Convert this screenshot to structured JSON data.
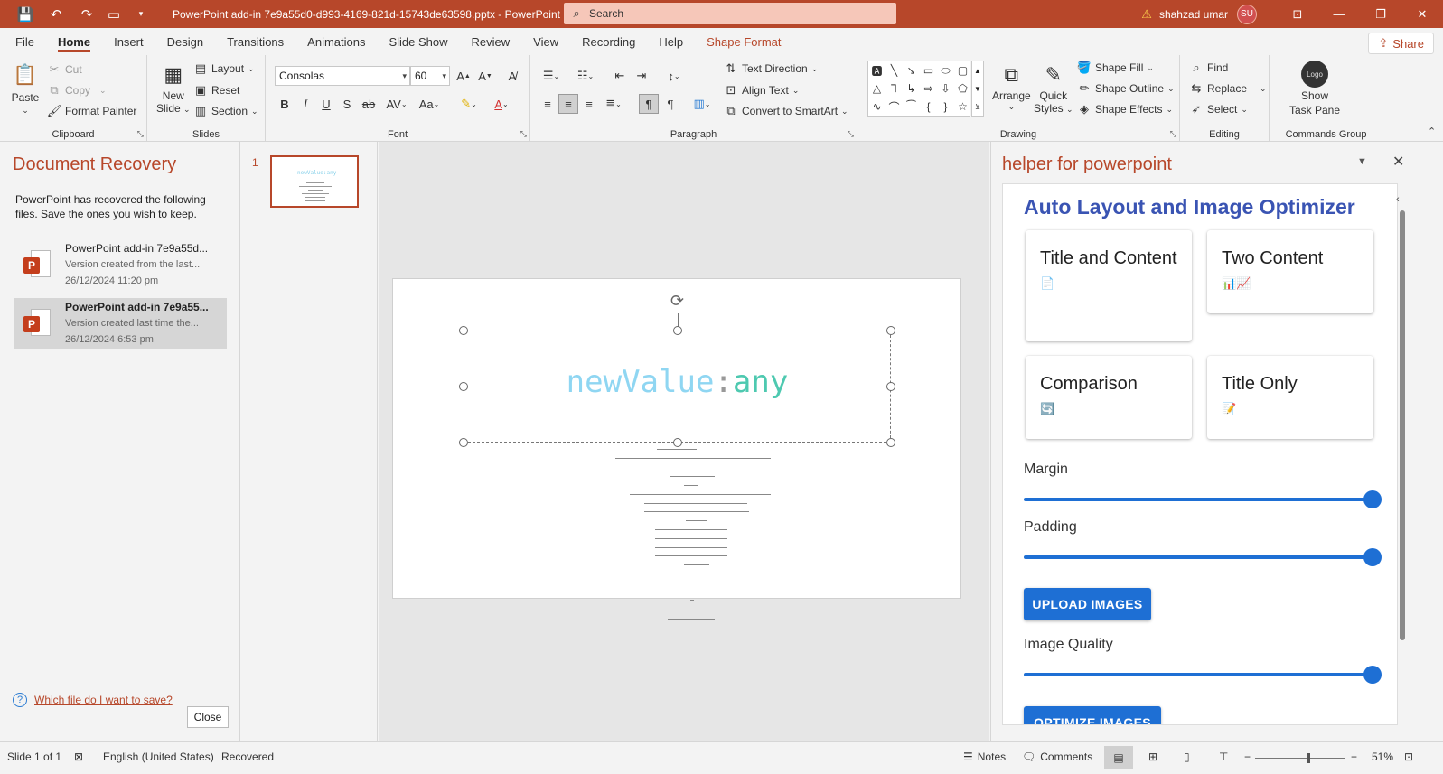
{
  "titlebar": {
    "doc_title": "PowerPoint add-in 7e9a55d0-d993-4169-821d-15743de63598.pptx  -  PowerPoint",
    "search_placeholder": "Search",
    "user_name": "shahzad umar",
    "user_initials": "SU"
  },
  "tabs": [
    "File",
    "Home",
    "Insert",
    "Design",
    "Transitions",
    "Animations",
    "Slide Show",
    "Review",
    "View",
    "Recording",
    "Help",
    "Shape Format"
  ],
  "active_tab": "Home",
  "share_label": "Share",
  "ribbon": {
    "clipboard": {
      "paste": "Paste",
      "cut": "Cut",
      "copy": "Copy",
      "format_painter": "Format Painter",
      "label": "Clipboard"
    },
    "slides": {
      "new_slide_line1": "New",
      "new_slide_line2": "Slide",
      "layout": "Layout",
      "reset": "Reset",
      "section": "Section",
      "label": "Slides"
    },
    "font": {
      "family": "Consolas",
      "size": "60",
      "label": "Font"
    },
    "paragraph": {
      "text_direction": "Text Direction",
      "align_text": "Align Text",
      "convert_smartart": "Convert to SmartArt",
      "label": "Paragraph"
    },
    "drawing": {
      "arrange": "Arrange",
      "quick_styles_line1": "Quick",
      "quick_styles_line2": "Styles",
      "shape_fill": "Shape Fill",
      "shape_outline": "Shape Outline",
      "shape_effects": "Shape Effects",
      "label": "Drawing"
    },
    "editing": {
      "find": "Find",
      "replace": "Replace",
      "select": "Select",
      "label": "Editing"
    },
    "commands": {
      "logo": "Logo",
      "show_line1": "Show",
      "show_line2": "Task Pane",
      "label": "Commands Group"
    }
  },
  "doc_recovery": {
    "title": "Document Recovery",
    "description": "PowerPoint has recovered the following files.  Save the ones you wish to keep.",
    "items": [
      {
        "name": "PowerPoint add-in 7e9a55d...",
        "subtitle": "Version created from the last...",
        "date": "26/12/2024 11:20 pm"
      },
      {
        "name": "PowerPoint add-in 7e9a55...",
        "subtitle": "Version created last time the...",
        "date": "26/12/2024 6:53 pm"
      }
    ],
    "help_link": "Which file do I want to save?",
    "close": "Close"
  },
  "thumbnails": {
    "slide_number": "1",
    "thumb_text": "newValue:any"
  },
  "slide": {
    "title_part1": "newValue",
    "title_sep": ":",
    "title_part2": "any"
  },
  "taskpane": {
    "title": "helper for powerpoint",
    "addin_title": "Auto Layout and Image Optimizer",
    "layouts": [
      {
        "title": "Title and Content",
        "icon": "📄"
      },
      {
        "title": "Two Content",
        "icon": "📊📈"
      },
      {
        "title": "Comparison",
        "icon": "🔄"
      },
      {
        "title": "Title Only",
        "icon": "📝"
      }
    ],
    "margin_label": "Margin",
    "margin_value": 1.0,
    "padding_label": "Padding",
    "padding_value": 1.0,
    "upload_label": "UPLOAD IMAGES",
    "quality_label": "Image Quality",
    "quality_value": 1.0,
    "optimize_label": "OPTIMIZE IMAGES"
  },
  "statusbar": {
    "slide_info": "Slide 1 of 1",
    "language": "English (United States)",
    "status": "Recovered",
    "notes": "Notes",
    "comments": "Comments",
    "zoom": "51%"
  },
  "colors": {
    "accent": "#b7472a",
    "addin_blue": "#1e6fd4",
    "addin_title": "#3a54b3"
  }
}
